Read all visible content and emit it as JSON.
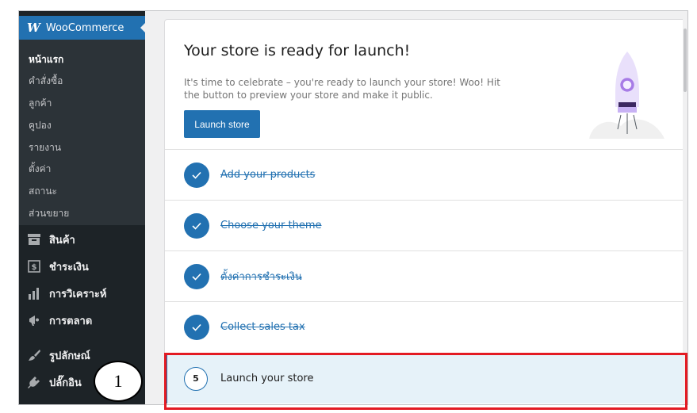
{
  "sidebar": {
    "brand": "WooCommerce",
    "submenu": [
      {
        "label": "หน้าแรก",
        "active": true
      },
      {
        "label": "คำสั่งซื้อ"
      },
      {
        "label": "ลูกค้า"
      },
      {
        "label": "คูปอง"
      },
      {
        "label": "รายงาน"
      },
      {
        "label": "ตั้งค่า"
      },
      {
        "label": "สถานะ"
      },
      {
        "label": "ส่วนขยาย"
      }
    ],
    "menu": [
      {
        "label": "สินค้า",
        "icon": "archive-icon"
      },
      {
        "label": "ชำระเงิน",
        "icon": "dollar-icon"
      },
      {
        "label": "การวิเคราะห์",
        "icon": "bar-chart-icon"
      },
      {
        "label": "การตลาด",
        "icon": "megaphone-icon"
      },
      {
        "label": "รูปลักษณ์",
        "icon": "brush-icon"
      },
      {
        "label": "ปลั๊กอิน",
        "icon": "plug-icon"
      }
    ]
  },
  "hero": {
    "title": "Your store is ready for launch!",
    "description": "It's time to celebrate – you're ready to launch your store! Woo! Hit the button to preview your store and make it public.",
    "button_label": "Launch store"
  },
  "tasks": [
    {
      "label": "Add your products",
      "completed": true
    },
    {
      "label": "Choose your theme",
      "completed": true
    },
    {
      "label": "ตั้งค่าการชำระเงิน",
      "completed": true
    },
    {
      "label": "Collect sales tax",
      "completed": true
    },
    {
      "label": "Launch your store",
      "completed": false,
      "number": "5"
    }
  ],
  "annotation": {
    "number": "1",
    "highlight_color": "#e31b23"
  },
  "colors": {
    "accent": "#2271b1",
    "sidebar_bg": "#1d2327",
    "submenu_bg": "#2c3338",
    "active_row_bg": "#e6f2f9"
  }
}
